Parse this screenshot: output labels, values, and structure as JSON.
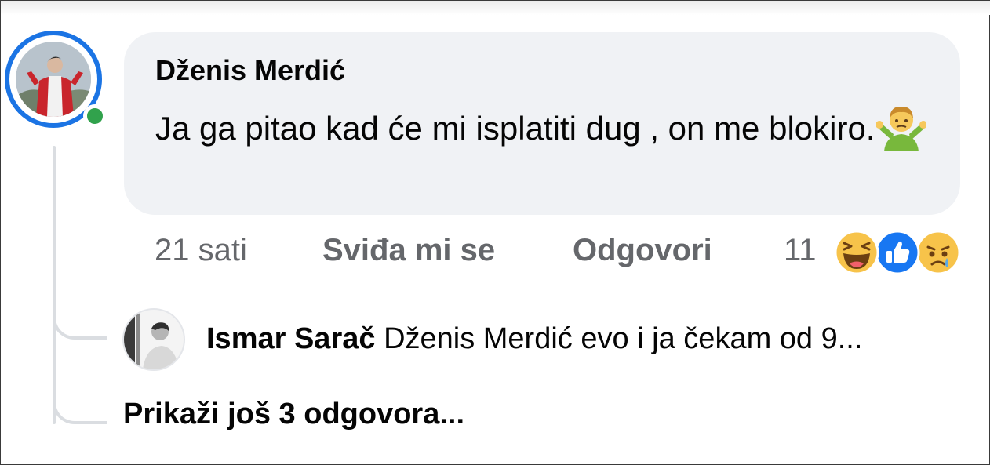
{
  "comment": {
    "author": "Dženis Merdić",
    "text": "Ja ga pitao kad će mi isplatiti dug , on me blokiro.",
    "emoji": "man-shrugging-icon"
  },
  "actions": {
    "time": "21 sati",
    "like_label": "Sviđa mi se",
    "reply_label": "Odgovori",
    "reaction_count": "11",
    "reactions": [
      "haha-reaction-icon",
      "like-reaction-icon",
      "sad-reaction-icon"
    ]
  },
  "reply": {
    "author": "Ismar Sarač",
    "text": "Dženis Merdić evo i ja čekam od 9..."
  },
  "more_replies": "Prikaži još 3 odgovora...",
  "colors": {
    "bubble": "#f0f2f5",
    "story_ring": "#1b74e4",
    "online": "#31a24c",
    "secondary_text": "#65676b",
    "thread_line": "#dadde1"
  }
}
